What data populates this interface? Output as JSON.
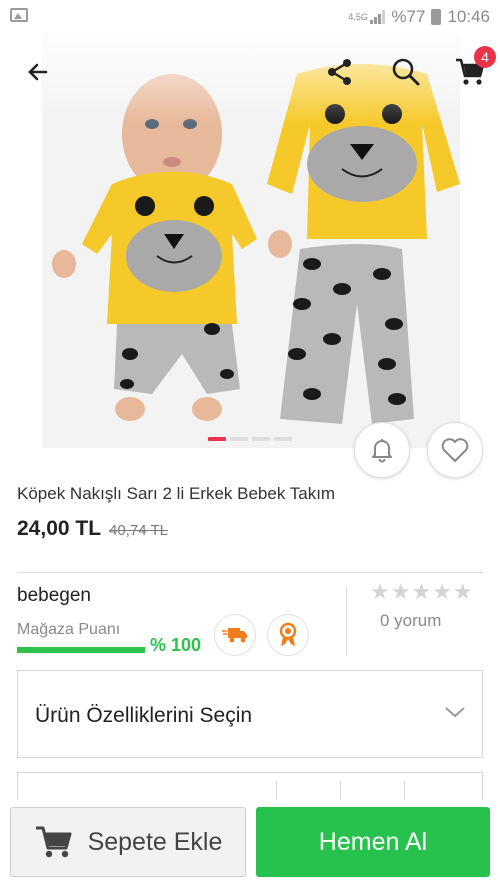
{
  "status_bar": {
    "network": "4.5G",
    "battery": "%77",
    "time": "10:46"
  },
  "toolbar": {
    "cart_count": "4"
  },
  "gallery": {
    "image_count": 4,
    "active_index": 0
  },
  "product": {
    "title": "Köpek Nakışlı Sarı 2 li Erkek Bebek Takım",
    "price": "24,00 TL",
    "old_price": "40,74 TL"
  },
  "seller": {
    "name": "bebegen",
    "score_label": "Mağaza Puanı",
    "score_value": "% 100",
    "score_fraction": 1.0
  },
  "reviews": {
    "rating": 0,
    "count_label": "0 yorum"
  },
  "options": {
    "label": "Ürün Özelliklerini Seçin"
  },
  "actions": {
    "add_to_cart": "Sepete Ekle",
    "buy_now": "Hemen Al"
  },
  "colors": {
    "accent_red": "#e8334a",
    "buy_green": "#27c24d",
    "badge_orange": "#f07d1a"
  }
}
